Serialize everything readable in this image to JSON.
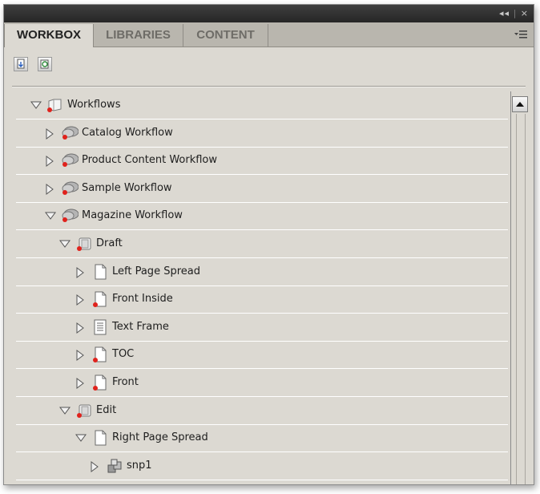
{
  "window": {
    "controls": {
      "collapse": "◂◂",
      "close": "×"
    }
  },
  "tabs": [
    {
      "label": "WORKBOX",
      "active": true
    },
    {
      "label": "LIBRARIES",
      "active": false
    },
    {
      "label": "CONTENT",
      "active": false
    }
  ],
  "toolbar": {
    "buttons": [
      {
        "icon": "checkout-document-icon"
      },
      {
        "icon": "refresh-document-icon"
      }
    ]
  },
  "tree": {
    "rows": [
      {
        "label": "Workflows",
        "expanded": true,
        "icon": "workflow-root-icon",
        "level": 0
      },
      {
        "label": "Catalog Workflow",
        "expanded": false,
        "icon": "workflow-icon",
        "level": 1
      },
      {
        "label": "Product Content Workflow",
        "expanded": false,
        "icon": "workflow-icon",
        "level": 1
      },
      {
        "label": "Sample Workflow",
        "expanded": false,
        "icon": "workflow-icon",
        "level": 1
      },
      {
        "label": "Magazine Workflow",
        "expanded": true,
        "icon": "workflow-icon",
        "level": 1
      },
      {
        "label": "Draft",
        "expanded": true,
        "icon": "stage-icon",
        "level": 2
      },
      {
        "label": "Left Page Spread",
        "expanded": false,
        "icon": "page-icon",
        "level": 3
      },
      {
        "label": "Front Inside",
        "expanded": false,
        "icon": "page-flagged-icon",
        "level": 3
      },
      {
        "label": "Text Frame",
        "expanded": false,
        "icon": "text-frame-icon",
        "level": 3
      },
      {
        "label": "TOC",
        "expanded": false,
        "icon": "page-flagged-icon",
        "level": 3
      },
      {
        "label": "Front",
        "expanded": false,
        "icon": "page-flagged-icon",
        "level": 3
      },
      {
        "label": "Edit",
        "expanded": true,
        "icon": "stage-icon",
        "level": 2
      },
      {
        "label": "Right Page Spread",
        "expanded": true,
        "icon": "page-icon",
        "level": 3
      },
      {
        "label": "snp1",
        "expanded": false,
        "icon": "snippet-icon",
        "level": 4
      }
    ]
  },
  "colors": {
    "panel_bg": "#dcd9d2",
    "titlebar": "#2f2f2f",
    "tabbar": "#b9b6ae",
    "flag_red": "#e0221c"
  }
}
